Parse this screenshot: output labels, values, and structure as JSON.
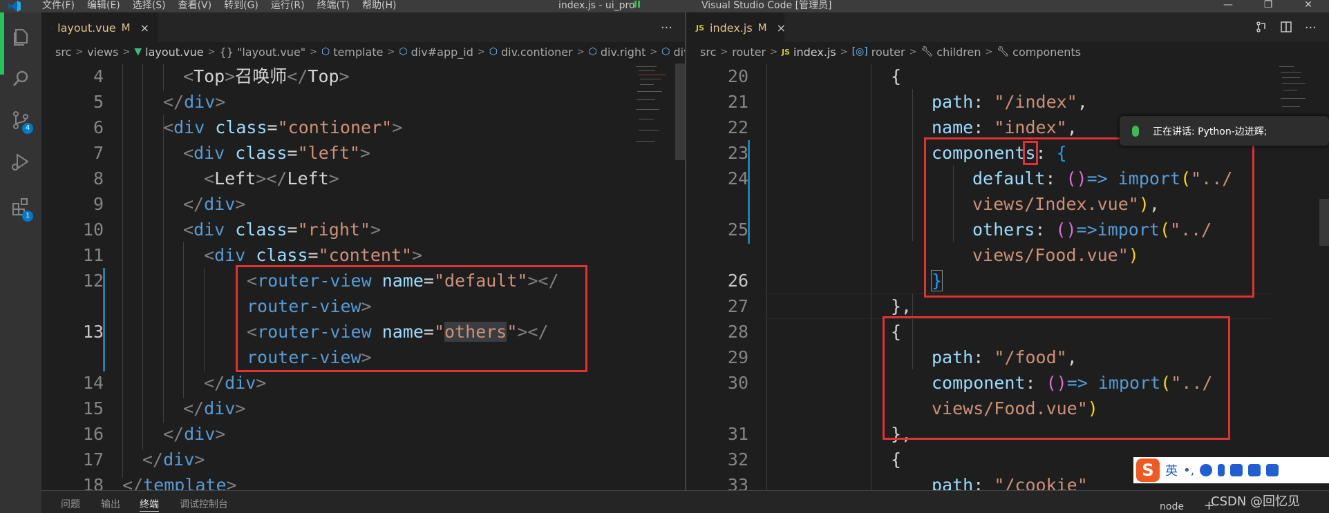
{
  "titlebar": {
    "menus": [
      "文件(F)",
      "编辑(E)",
      "选择(S)",
      "查看(V)",
      "转到(G)",
      "运行(R)",
      "终端(T)",
      "帮助(H)"
    ],
    "title": "index.js - ui_pro",
    "title_suffix": "Visual Studio Code [管理员]",
    "minimize": "—",
    "maximize": "❐",
    "close": "✕"
  },
  "activitybar": {
    "icons": [
      "explorer-icon",
      "search-icon",
      "source-control-icon",
      "run-debug-icon",
      "extensions-icon"
    ],
    "source_control_badge": "4",
    "extensions_badge": "1"
  },
  "left_editor": {
    "tab": {
      "name": "layout.vue",
      "modified": "M",
      "close": "×"
    },
    "more": "···",
    "breadcrumb": [
      "src",
      "views",
      "layout.vue",
      "{} \"layout.vue\"",
      "template",
      "div#app_id",
      "div.contioner",
      "div.right",
      "div.conter"
    ],
    "lines": [
      {
        "n": "4"
      },
      {
        "n": "5"
      },
      {
        "n": "6"
      },
      {
        "n": "7"
      },
      {
        "n": "8"
      },
      {
        "n": "9"
      },
      {
        "n": "10"
      },
      {
        "n": "11"
      },
      {
        "n": "12"
      },
      {
        "n": "13"
      },
      {
        "n": "14"
      },
      {
        "n": "15"
      },
      {
        "n": "16"
      },
      {
        "n": "17"
      },
      {
        "n": "18"
      }
    ],
    "code": {
      "l4_text": "召唤师",
      "top": "Top",
      "div": "div",
      "class": "class",
      "contioner": "\"contioner\"",
      "left": "\"left\"",
      "left_comp": "Left",
      "right": "\"right\"",
      "content": "\"content\"",
      "router_view": "router-view",
      "name": "name",
      "default": "\"default\"",
      "others": "others",
      "template": "template"
    }
  },
  "right_editor": {
    "tab": {
      "name": "index.js",
      "modified": "M",
      "close": "×",
      "badge": "JS"
    },
    "breadcrumb": [
      "src",
      "router",
      "index.js",
      "router",
      "children",
      "components"
    ],
    "lines": [
      {
        "n": "20"
      },
      {
        "n": "21"
      },
      {
        "n": "22"
      },
      {
        "n": "23"
      },
      {
        "n": "24"
      },
      {
        "n": "25"
      },
      {
        "n": "26"
      },
      {
        "n": "27"
      },
      {
        "n": "28"
      },
      {
        "n": "29"
      },
      {
        "n": "30"
      },
      {
        "n": "31"
      },
      {
        "n": "32"
      },
      {
        "n": "33"
      }
    ],
    "code": {
      "path": "path",
      "index_path": "\"/index\"",
      "name": "name",
      "index_name": "\"index\"",
      "components_pre": "component",
      "components_s": "s",
      "default": "default",
      "others": "others",
      "import": "import",
      "index_vue_1": "\"../",
      "index_vue_2": "views/Index.vue\"",
      "food_vue_1": "\"../",
      "food_vue_2": "views/Food.vue\"",
      "food_path": "\"/food\"",
      "component": "component",
      "cookie_path": "\"/cookie\""
    }
  },
  "voice_toast": {
    "text": "正在讲话: Python-边进辉;"
  },
  "panel": {
    "tabs": [
      "问题",
      "输出",
      "终端",
      "调试控制台"
    ],
    "active_tab": "终端",
    "terminal_name": "node",
    "plus": "+"
  },
  "ime": {
    "logo": "S",
    "lang": "英",
    "punct": "•,"
  },
  "watermark": "CSDN @回忆见",
  "colors": {
    "accent": "#007acc",
    "highlight_box": "#e03232",
    "active_indicator": "#22c55e"
  }
}
